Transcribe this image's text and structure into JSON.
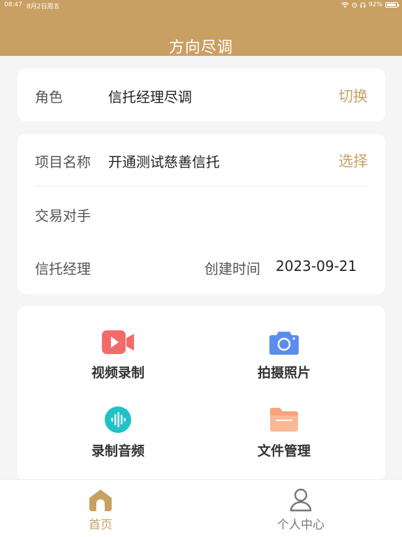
{
  "status_bar": {
    "time": "08:47",
    "date": "8月2日周五",
    "battery": "92%",
    "battery_level": 0.92
  },
  "header": {
    "title": "方向尽调"
  },
  "role_card": {
    "label": "角色",
    "value": "信托经理尽调",
    "action": "切换"
  },
  "project_card": {
    "name_label": "项目名称",
    "name_value": "开通测试慈善信托",
    "name_action": "选择",
    "counterparty_label": "交易对手",
    "manager_label": "信托经理",
    "created_label": "创建时间",
    "created_value": "2023-09-21"
  },
  "tools": [
    {
      "label": "视频录制",
      "icon": "video-camera-icon"
    },
    {
      "label": "拍摄照片",
      "icon": "camera-icon"
    },
    {
      "label": "录制音频",
      "icon": "audio-wave-icon"
    },
    {
      "label": "文件管理",
      "icon": "folder-icon"
    }
  ],
  "tabbar": {
    "home": "首页",
    "profile": "个人中心"
  },
  "colors": {
    "brand": "#c9a063",
    "video": "#f26b6b",
    "camera": "#5b8def",
    "audio": "#1fc2c9",
    "folder": "#f7a37c"
  }
}
